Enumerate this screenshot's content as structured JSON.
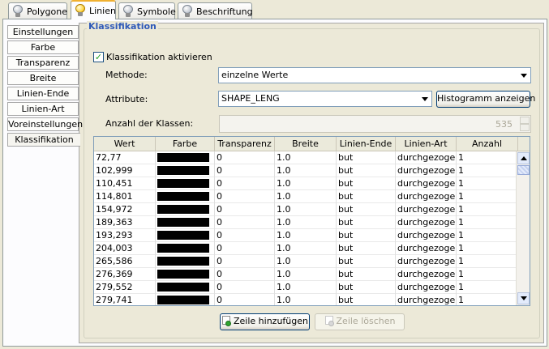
{
  "tabs": [
    {
      "label": "Polygone",
      "active": false,
      "icon": "bulb-off-icon"
    },
    {
      "label": "Linien",
      "active": true,
      "icon": "bulb-on-icon"
    },
    {
      "label": "Symbole",
      "active": false,
      "icon": "bulb-off-icon"
    },
    {
      "label": "Beschriftung",
      "active": false,
      "icon": "bulb-off-icon"
    }
  ],
  "sidebar": {
    "items": [
      {
        "label": "Einstellungen"
      },
      {
        "label": "Farbe"
      },
      {
        "label": "Transparenz"
      },
      {
        "label": "Breite"
      },
      {
        "label": "Linien-Ende"
      },
      {
        "label": "Linien-Art"
      },
      {
        "label": "Voreinstellungen"
      },
      {
        "label": "Klassifikation",
        "selected": true
      }
    ]
  },
  "panel": {
    "title": "Klassifikation",
    "activate_label": "Klassifikation aktivieren",
    "activate_checked": true,
    "method_label": "Methode:",
    "method_value": "einzelne Werte",
    "attribute_label": "Attribute:",
    "attribute_value": "SHAPE_LENG",
    "histogram_button": "Histogramm anzeigen",
    "classes_label": "Anzahl der Klassen:",
    "classes_value": "535"
  },
  "table": {
    "columns": [
      "Wert",
      "Farbe",
      "Transparenz",
      "Breite",
      "Linien-Ende",
      "Linien-Art",
      "Anzahl"
    ],
    "rows": [
      {
        "wert": "72,77",
        "farbe": "#000000",
        "transparenz": "0",
        "breite": "1.0",
        "ende": "but",
        "art": "durchgezogen",
        "anzahl": "1"
      },
      {
        "wert": "102,999",
        "farbe": "#000000",
        "transparenz": "0",
        "breite": "1.0",
        "ende": "but",
        "art": "durchgezogen",
        "anzahl": "1"
      },
      {
        "wert": "110,451",
        "farbe": "#000000",
        "transparenz": "0",
        "breite": "1.0",
        "ende": "but",
        "art": "durchgezogen",
        "anzahl": "1"
      },
      {
        "wert": "114,801",
        "farbe": "#000000",
        "transparenz": "0",
        "breite": "1.0",
        "ende": "but",
        "art": "durchgezogen",
        "anzahl": "1"
      },
      {
        "wert": "154,972",
        "farbe": "#000000",
        "transparenz": "0",
        "breite": "1.0",
        "ende": "but",
        "art": "durchgezogen",
        "anzahl": "1"
      },
      {
        "wert": "189,363",
        "farbe": "#000000",
        "transparenz": "0",
        "breite": "1.0",
        "ende": "but",
        "art": "durchgezogen",
        "anzahl": "1"
      },
      {
        "wert": "193,293",
        "farbe": "#000000",
        "transparenz": "0",
        "breite": "1.0",
        "ende": "but",
        "art": "durchgezogen",
        "anzahl": "1"
      },
      {
        "wert": "204,003",
        "farbe": "#000000",
        "transparenz": "0",
        "breite": "1.0",
        "ende": "but",
        "art": "durchgezogen",
        "anzahl": "1"
      },
      {
        "wert": "265,586",
        "farbe": "#000000",
        "transparenz": "0",
        "breite": "1.0",
        "ende": "but",
        "art": "durchgezogen",
        "anzahl": "1"
      },
      {
        "wert": "276,369",
        "farbe": "#000000",
        "transparenz": "0",
        "breite": "1.0",
        "ende": "but",
        "art": "durchgezogen",
        "anzahl": "1"
      },
      {
        "wert": "279,552",
        "farbe": "#000000",
        "transparenz": "0",
        "breite": "1.0",
        "ende": "but",
        "art": "durchgezogen",
        "anzahl": "1"
      },
      {
        "wert": "279,741",
        "farbe": "#000000",
        "transparenz": "0",
        "breite": "1.0",
        "ende": "but",
        "art": "durchgezogen",
        "anzahl": "1"
      }
    ]
  },
  "buttons": {
    "add_row": "Zeile hinzufügen",
    "delete_row": "Zeile löschen"
  },
  "colors": {
    "title_blue": "#2f5ab8",
    "active_tab_accent": "#f0b030"
  }
}
